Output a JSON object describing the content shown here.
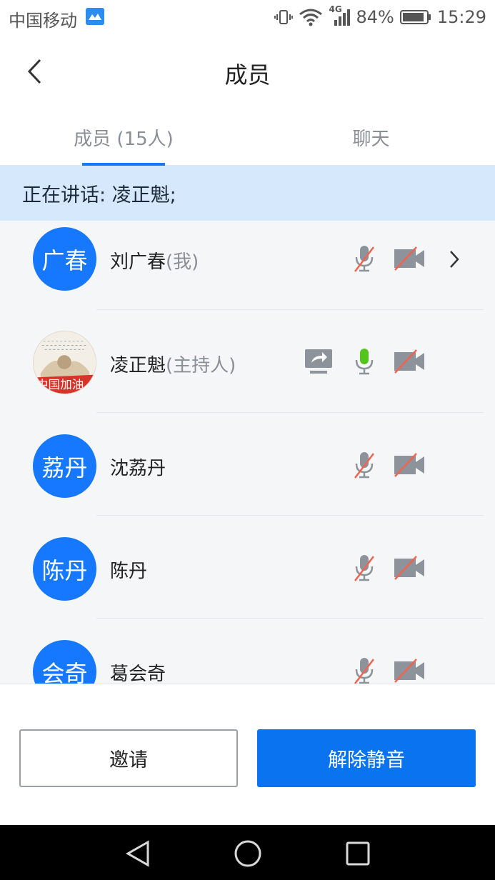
{
  "status_bar": {
    "carrier": "中国移动",
    "network": "4G",
    "battery": "84%",
    "time": "15:29"
  },
  "header": {
    "title": "成员"
  },
  "tabs": [
    {
      "label": "成员 (15人)",
      "active": true
    },
    {
      "label": "聊天",
      "active": false
    }
  ],
  "speaking_banner": "正在讲话: 凌正魁;",
  "members": [
    {
      "avatar_text": "广春",
      "name": "刘广春",
      "role": "(我)",
      "mic": "muted",
      "camera": "off",
      "has_chevron": true,
      "sharing": false
    },
    {
      "avatar_text": "中国加油",
      "name": "凌正魁",
      "role": "(主持人)",
      "mic": "active",
      "camera": "off",
      "has_chevron": false,
      "sharing": true
    },
    {
      "avatar_text": "荔丹",
      "name": "沈荔丹",
      "role": "",
      "mic": "muted",
      "camera": "off",
      "has_chevron": false,
      "sharing": false
    },
    {
      "avatar_text": "陈丹",
      "name": "陈丹",
      "role": "",
      "mic": "muted",
      "camera": "off",
      "has_chevron": false,
      "sharing": false
    },
    {
      "avatar_text": "会奇",
      "name": "葛会奇",
      "role": "",
      "mic": "muted",
      "camera": "off",
      "has_chevron": false,
      "sharing": false
    }
  ],
  "actions": {
    "invite_label": "邀请",
    "unmute_label": "解除静音"
  },
  "colors": {
    "accent": "#1677ff",
    "banner_bg": "#d6e8fb",
    "mic_active": "#52c41a",
    "muted_slash": "#f06450"
  }
}
